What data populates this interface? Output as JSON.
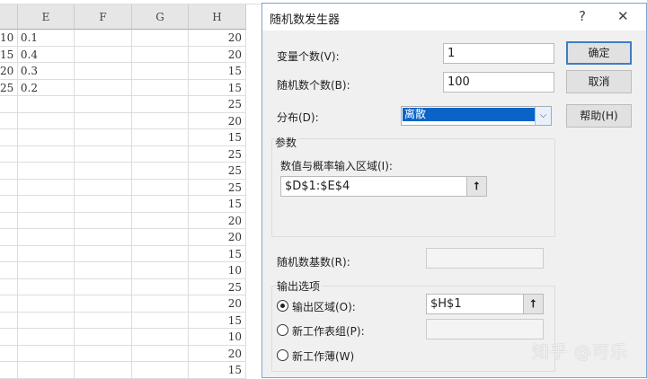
{
  "sheet": {
    "columns": [
      "E",
      "F",
      "G",
      "H"
    ],
    "col_d": [
      "10",
      "15",
      "20",
      "25"
    ],
    "col_e": [
      "0.1",
      "0.4",
      "0.3",
      "0.2"
    ],
    "col_h": [
      "20",
      "20",
      "15",
      "15",
      "25",
      "20",
      "15",
      "25",
      "25",
      "25",
      "15",
      "20",
      "20",
      "15",
      "10",
      "25",
      "20",
      "15",
      "10",
      "20",
      "15"
    ]
  },
  "dialog": {
    "title": "随机数发生器",
    "help_glyph": "?",
    "close_glyph": "✕",
    "num_vars_label": "变量个数(V):",
    "num_vars_value": "1",
    "num_random_label": "随机数个数(B):",
    "num_random_value": "100",
    "dist_label": "分布(D):",
    "dist_value": "离散",
    "params_label": "参数",
    "value_prob_label": "数值与概率输入区域(I):",
    "value_prob_value": "$D$1:$E$4",
    "seed_label": "随机数基数(R):",
    "seed_value": "",
    "output_label": "输出选项",
    "out_range_label": "输出区域(O):",
    "out_range_value": "$H$1",
    "new_sheet_label": "新工作表组(P):",
    "new_sheet_value": "",
    "new_book_label": "新工作薄(W)",
    "ok": "确定",
    "cancel": "取消",
    "help": "帮助(H)"
  },
  "watermark": "知乎 @可乐"
}
